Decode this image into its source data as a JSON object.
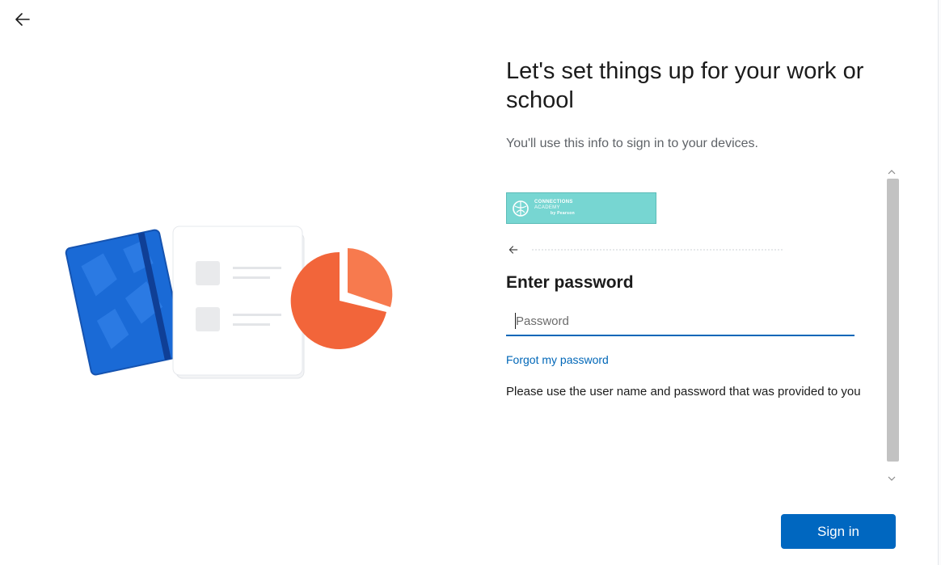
{
  "header": {
    "back_icon": "arrow-left-icon"
  },
  "title": "Let's set things up for your work or school",
  "subtitle": "You'll use this info to sign in to your devices.",
  "signin": {
    "org_logo": {
      "icon": "globe-logo-icon",
      "line1": "CONNECTIONS",
      "line2": "ACADEMY",
      "line3": "by Pearson",
      "color": "#77d6d2"
    },
    "identity_back_icon": "arrow-left-icon",
    "heading": "Enter password",
    "password": {
      "placeholder": "Password",
      "value": ""
    },
    "forgot_link": "Forgot my password",
    "info_text": "Please use the user name and password that was provided to you"
  },
  "scrollbar": {
    "up_icon": "scroll-up-arrow-icon",
    "down_icon": "scroll-down-arrow-icon"
  },
  "footer": {
    "signin_label": "Sign in",
    "accent_color": "#0067c0"
  },
  "illustration": {
    "items": [
      "notebook-icon",
      "checklist-card-icon",
      "pie-chart-icon"
    ],
    "pie_color": "#f2653a",
    "notebook_color": "#1a6ad6"
  }
}
